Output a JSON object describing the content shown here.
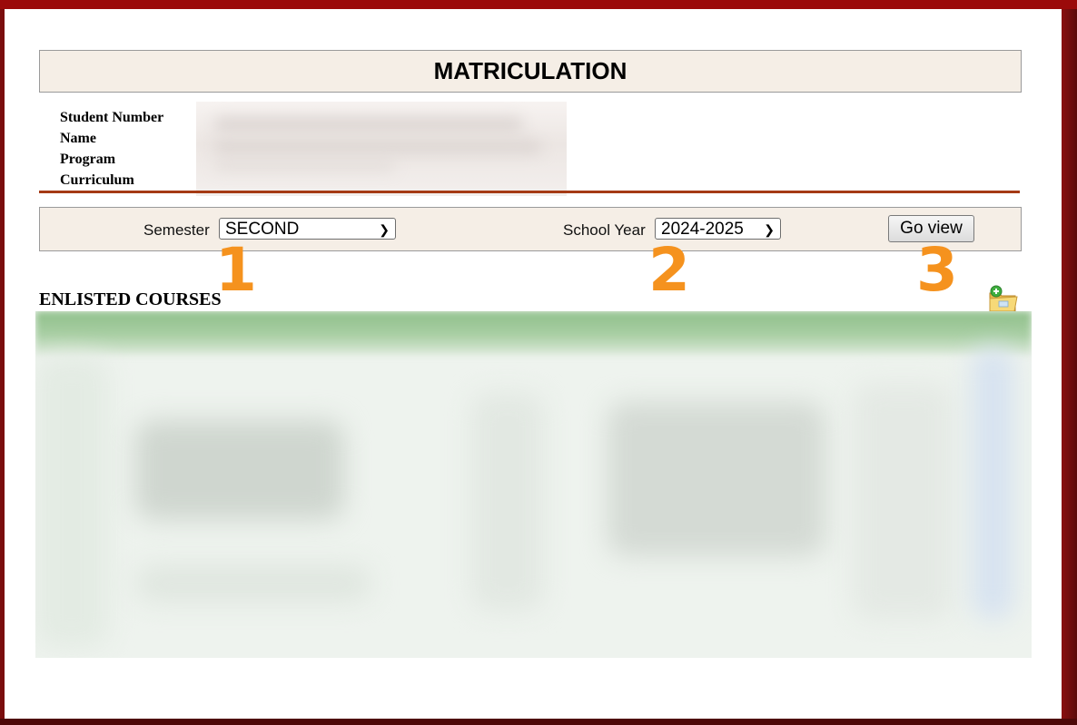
{
  "page_title": "MATRICULATION",
  "student_info": {
    "labels": [
      "Student Number",
      "Name",
      "Program",
      "Curriculum"
    ]
  },
  "filters": {
    "semester_label": "Semester",
    "semester_value": "SECOND",
    "school_year_label": "School Year",
    "school_year_value": "2024-2025",
    "go_button": "Go view"
  },
  "step_markers": [
    "1",
    "2",
    "3"
  ],
  "section_title": "ENLISTED COURSES",
  "icons": {
    "folder": "folder-add-icon",
    "dropdown": "chevron-down-icon"
  },
  "colors": {
    "frame": "#9b0a0a",
    "panel_bg": "#f5eee6",
    "rule": "#a53a14",
    "marker": "#f5921e",
    "table_header": "#8fbf8a"
  }
}
